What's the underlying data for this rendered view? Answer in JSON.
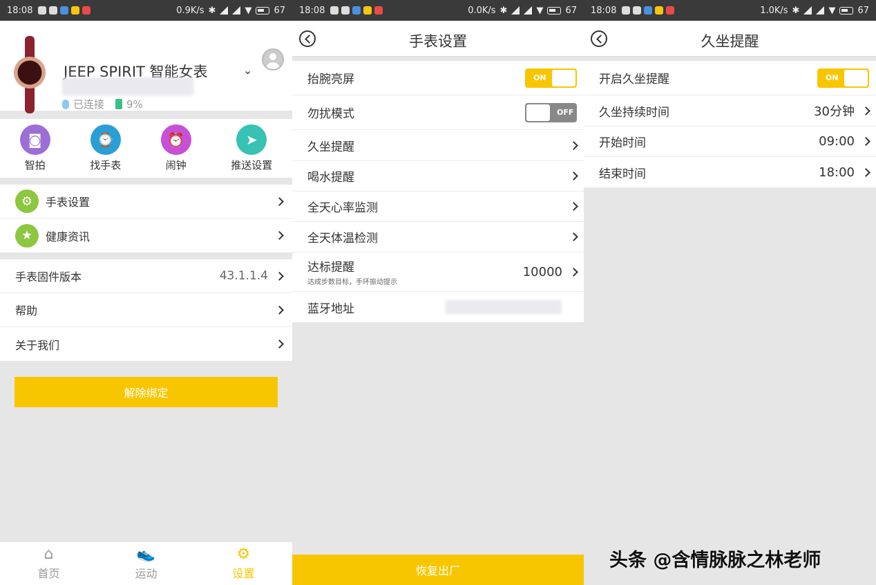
{
  "status_bars": [
    {
      "time": "18:08",
      "speed": "0.9K/s",
      "battery": "67"
    },
    {
      "time": "18:08",
      "speed": "0.0K/s",
      "battery": "67"
    },
    {
      "time": "18:08",
      "speed": "1.0K/s",
      "battery": "67"
    }
  ],
  "panel1": {
    "device_name": "JEEP SPIRIT 智能女表",
    "connection_status": "已连接",
    "battery": "9%",
    "quick_actions": [
      {
        "label": "智拍",
        "icon": "camera-icon",
        "color": "#9b6fd6"
      },
      {
        "label": "找手表",
        "icon": "find-watch-icon",
        "color": "#2a9fd6"
      },
      {
        "label": "闹钟",
        "icon": "alarm-icon",
        "color": "#c651d6"
      },
      {
        "label": "推送设置",
        "icon": "send-icon",
        "color": "#37c2b4"
      }
    ],
    "menu1": [
      {
        "label": "手表设置",
        "icon": "gear-icon"
      },
      {
        "label": "健康资讯",
        "icon": "star-icon"
      }
    ],
    "menu2": [
      {
        "label": "手表固件版本",
        "value": "43.1.1.4"
      },
      {
        "label": "帮助",
        "value": ""
      },
      {
        "label": "关于我们",
        "value": ""
      }
    ],
    "unbind_label": "解除绑定",
    "tabs": [
      {
        "label": "首页",
        "icon": "home-icon"
      },
      {
        "label": "运动",
        "icon": "shoe-icon"
      },
      {
        "label": "设置",
        "icon": "settings-icon"
      }
    ]
  },
  "panel2": {
    "title": "手表设置",
    "toggle_rows": [
      {
        "label": "抬腕亮屏",
        "state": "ON"
      },
      {
        "label": "勿扰模式",
        "state": "OFF"
      }
    ],
    "nav_rows": [
      {
        "label": "久坐提醒"
      },
      {
        "label": "喝水提醒"
      },
      {
        "label": "全天心率监测"
      },
      {
        "label": "全天体温检测"
      }
    ],
    "goal_row": {
      "label": "达标提醒",
      "sub": "达成步数目标，手环振动提示",
      "value": "10000"
    },
    "bt_row": {
      "label": "蓝牙地址"
    },
    "restore_label": "恢复出厂"
  },
  "panel3": {
    "title": "久坐提醒",
    "toggle_row": {
      "label": "开启久坐提醒",
      "state": "ON"
    },
    "rows": [
      {
        "label": "久坐持续时间",
        "value": "30分钟"
      },
      {
        "label": "开始时间",
        "value": "09:00"
      },
      {
        "label": "结束时间",
        "value": "18:00"
      }
    ]
  },
  "watermark": "头条 @含情脉脉之林老师"
}
